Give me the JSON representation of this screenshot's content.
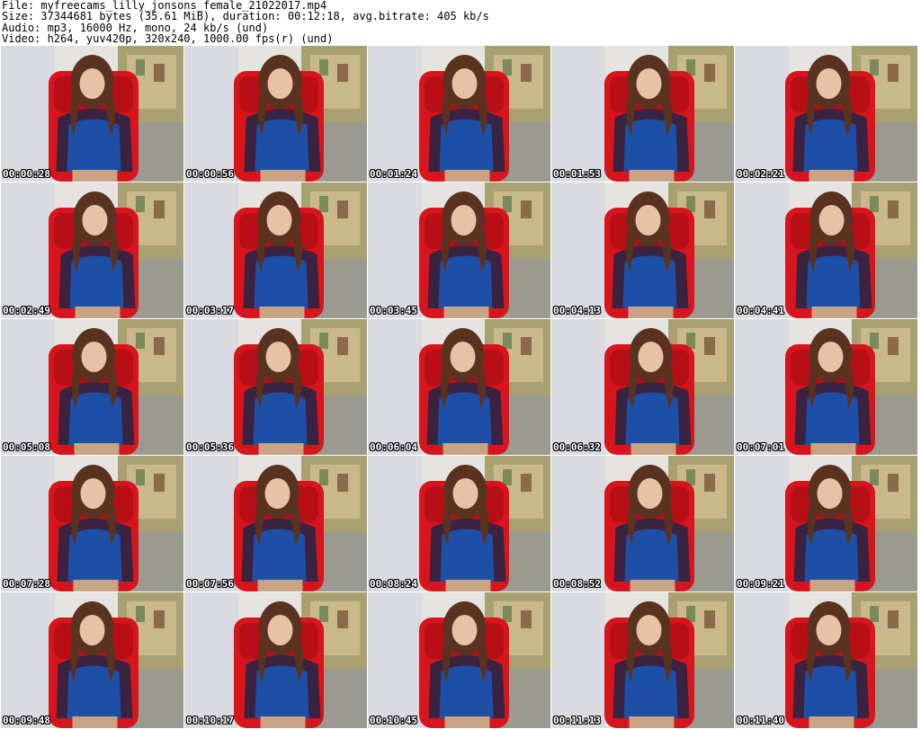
{
  "header": {
    "file": "File: myfreecams_lilly_jonsons_female_21022017.mp4",
    "size": "Size: 37344681 bytes (35.61 MiB), duration: 00:12:18, avg.bitrate: 405 kb/s",
    "audio": "Audio: mp3, 16000 Hz, mono, 24 kb/s (und)",
    "video": "Video: h264, yuv420p, 320x240, 1000.00 fps(r) (und)"
  },
  "colors": {
    "chair": "#d8141c",
    "shirt": "#1e4fa6",
    "hair": "#5a3220",
    "plaid": "#3a2340",
    "wall": "#e6e4e0",
    "background_painting": "#a8a070",
    "skin": "#e8c2a6"
  },
  "thumbnails": [
    {
      "timestamp": "00:00:28"
    },
    {
      "timestamp": "00:00:56"
    },
    {
      "timestamp": "00:01:24"
    },
    {
      "timestamp": "00:01:53"
    },
    {
      "timestamp": "00:02:21"
    },
    {
      "timestamp": "00:02:49"
    },
    {
      "timestamp": "00:03:17"
    },
    {
      "timestamp": "00:03:45"
    },
    {
      "timestamp": "00:04:13"
    },
    {
      "timestamp": "00:04:41"
    },
    {
      "timestamp": "00:05:08"
    },
    {
      "timestamp": "00:05:36"
    },
    {
      "timestamp": "00:06:04"
    },
    {
      "timestamp": "00:06:32"
    },
    {
      "timestamp": "00:07:01"
    },
    {
      "timestamp": "00:07:28"
    },
    {
      "timestamp": "00:07:56"
    },
    {
      "timestamp": "00:08:24"
    },
    {
      "timestamp": "00:08:52"
    },
    {
      "timestamp": "00:09:21"
    },
    {
      "timestamp": "00:09:48"
    },
    {
      "timestamp": "00:10:17"
    },
    {
      "timestamp": "00:10:45"
    },
    {
      "timestamp": "00:11:13"
    },
    {
      "timestamp": "00:11:40"
    }
  ]
}
